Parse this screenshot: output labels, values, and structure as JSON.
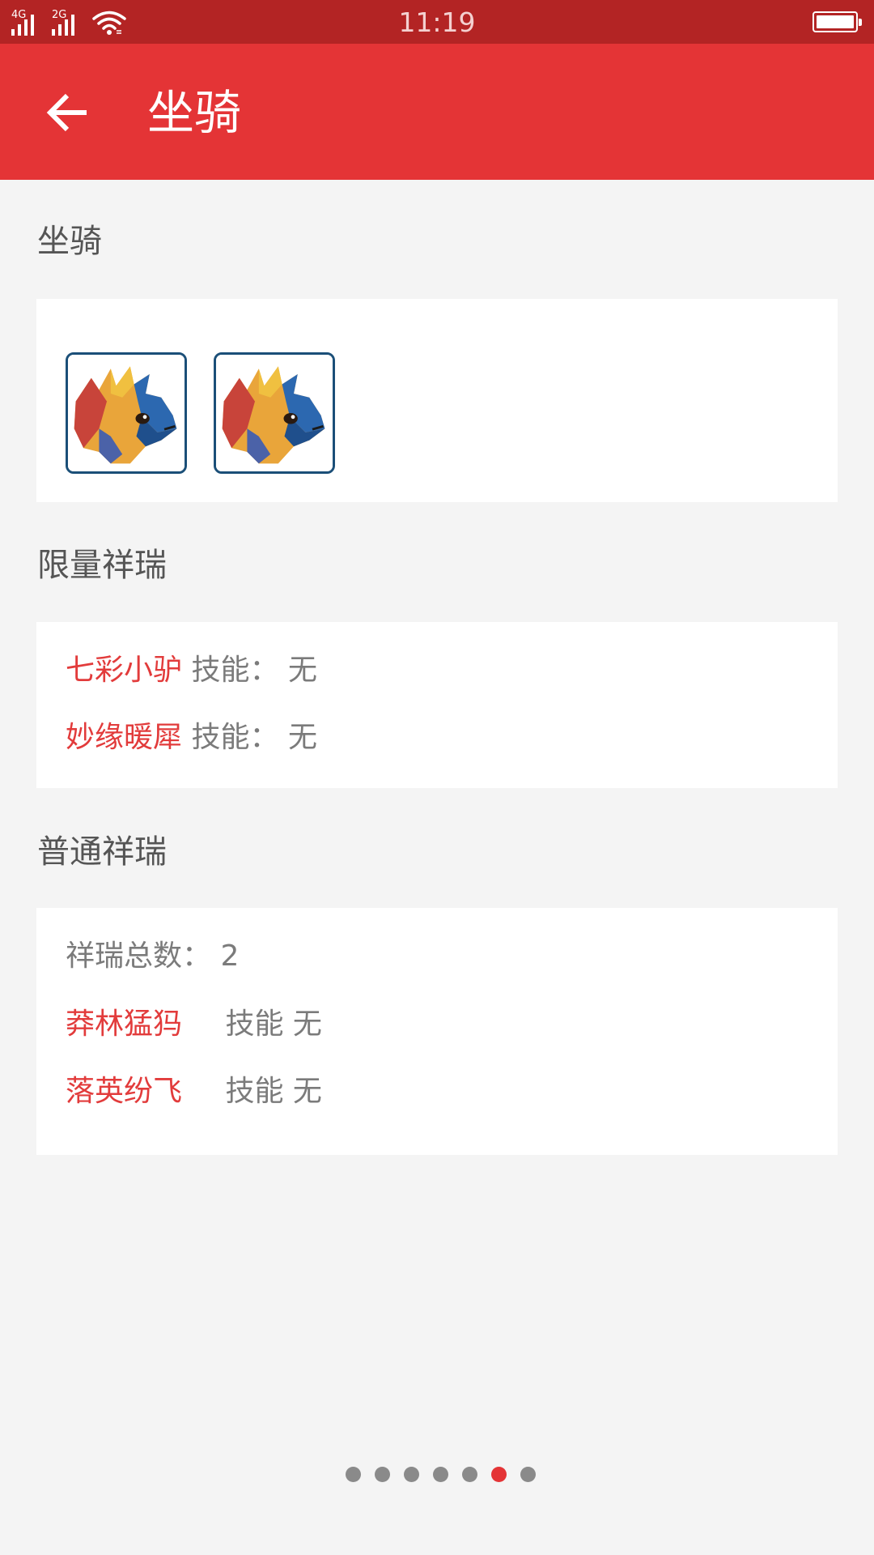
{
  "status_bar": {
    "network_1": "4G",
    "network_2": "2G",
    "time": "11:19",
    "icons": [
      "signal-icon",
      "signal-icon",
      "wifi-icon",
      "battery-icon"
    ]
  },
  "app_bar": {
    "back_icon": "arrow-left-icon",
    "title": "坐骑"
  },
  "mounts_section": {
    "title": "坐骑",
    "items": [
      {
        "name": "mount-avatar-1"
      },
      {
        "name": "mount-avatar-2"
      }
    ]
  },
  "limited_section": {
    "title": "限量祥瑞",
    "items": [
      {
        "name": "七彩小驴",
        "skill_label": "技能：",
        "skill_value": "无"
      },
      {
        "name": "妙缘暖犀",
        "skill_label": "技能：",
        "skill_value": "无"
      }
    ]
  },
  "normal_section": {
    "title": "普通祥瑞",
    "total_label": "祥瑞总数：",
    "total_value": "2",
    "items": [
      {
        "name": "莽林猛犸",
        "skill_label": "技能",
        "skill_value": "无"
      },
      {
        "name": "落英纷飞",
        "skill_label": "技能",
        "skill_value": "无"
      }
    ]
  },
  "pager": {
    "count": 7,
    "active_index": 5
  },
  "colors": {
    "status_bar": "#b32424",
    "app_bar": "#e43436",
    "accent_red": "#e23b3b",
    "background": "#f4f4f4"
  }
}
